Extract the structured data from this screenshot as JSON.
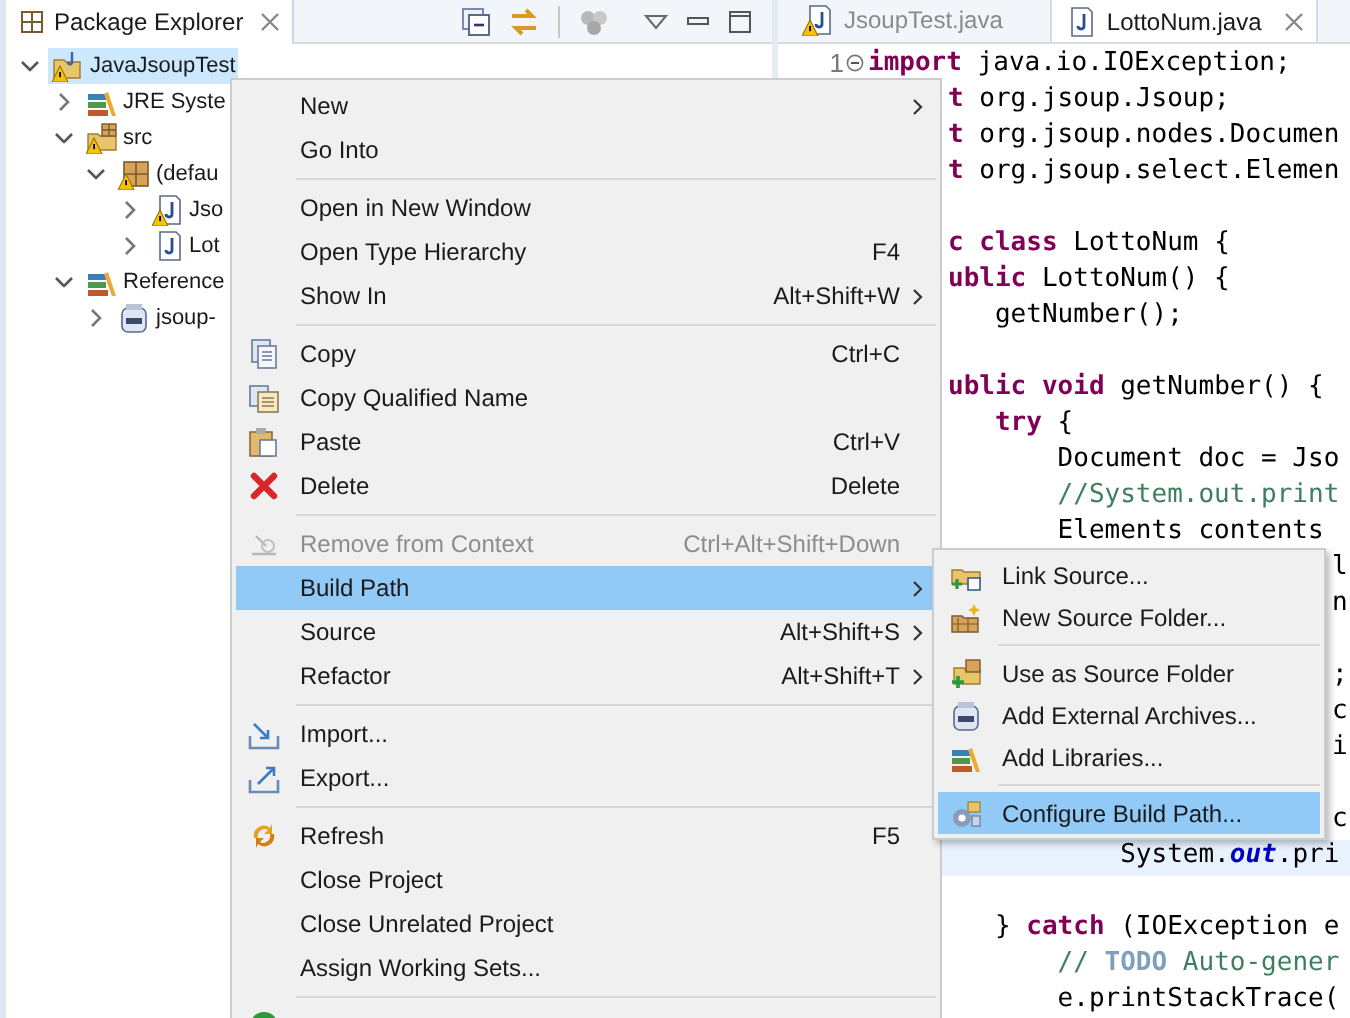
{
  "package_explorer": {
    "title": "Package Explorer",
    "selected": true,
    "tree": [
      {
        "label": "JavaJsoupTest",
        "kind": "project",
        "expanded": true,
        "selected": true,
        "warning": true,
        "children": [
          {
            "label": "JRE Syste",
            "kind": "library",
            "expanded": false,
            "selected": false
          },
          {
            "label": "src",
            "kind": "folder",
            "expanded": true,
            "selected": false,
            "warning": true,
            "children": [
              {
                "label": "(defau",
                "kind": "package",
                "expanded": true,
                "selected": false,
                "warning": true,
                "children": [
                  {
                    "label": "Jso",
                    "kind": "file",
                    "expanded": false,
                    "selected": false,
                    "warning": true
                  },
                  {
                    "label": "Lot",
                    "kind": "file",
                    "expanded": false,
                    "selected": false,
                    "warning": false
                  }
                ]
              }
            ]
          },
          {
            "label": "Reference",
            "kind": "library",
            "expanded": true,
            "selected": false,
            "children": [
              {
                "label": "jsoup-",
                "kind": "jar",
                "expanded": false,
                "selected": false
              }
            ]
          }
        ]
      }
    ]
  },
  "editor": {
    "tabs": [
      {
        "label": "JsoupTest.java",
        "selected": false,
        "warning": true
      },
      {
        "label": "LottoNum.java",
        "selected": true,
        "warning": false
      }
    ],
    "lines": [
      {
        "kind": "full",
        "number": "1",
        "text": "**import** java.io.IOException;",
        "comment": false,
        "current": false
      },
      {
        "kind": "cut",
        "text": "**t** org.jsoup.Jsoup;",
        "comment": false,
        "current": false
      },
      {
        "kind": "cut",
        "text": "**t** org.jsoup.nodes.Documen",
        "comment": false,
        "current": false
      },
      {
        "kind": "cut",
        "text": "**t** org.jsoup.select.Elemen",
        "comment": false,
        "current": false
      },
      {
        "kind": "blank"
      },
      {
        "kind": "cut",
        "text": "**c class** LottoNum {",
        "comment": false,
        "current": false
      },
      {
        "kind": "cut",
        "text": "**ublic** LottoNum() {",
        "comment": false,
        "current": false
      },
      {
        "kind": "cut",
        "text": "   getNumber();",
        "comment": false,
        "current": false
      },
      {
        "kind": "blank"
      },
      {
        "kind": "cut",
        "text": "**ublic void** getNumber() {",
        "comment": false,
        "current": false
      },
      {
        "kind": "cut",
        "text": "   **try** {",
        "comment": false,
        "current": false
      },
      {
        "kind": "cut",
        "text": "       Document doc = Jso",
        "comment": false,
        "current": false
      },
      {
        "kind": "cut",
        "text": "       //System.out.print",
        "comment": true,
        "current": false
      },
      {
        "kind": "cut",
        "text": "       Elements contents",
        "comment": false,
        "current": false
      },
      {
        "kind": "tail",
        "text": "l"
      },
      {
        "kind": "tail",
        "text": "n"
      },
      {
        "kind": "blank"
      },
      {
        "kind": "tail",
        "text": ";"
      },
      {
        "kind": "tail",
        "text": "c"
      },
      {
        "kind": "tail",
        "text": "i"
      },
      {
        "kind": "blank"
      },
      {
        "kind": "tail",
        "text": "c"
      },
      {
        "kind": "cut",
        "text": "           System.*out*.pri",
        "comment": false,
        "current": true
      },
      {
        "kind": "blank"
      },
      {
        "kind": "cut",
        "text": "   } **catch** (IOException e",
        "comment": false,
        "current": false
      },
      {
        "kind": "cut",
        "text": "       // **TODO** Auto-gener",
        "comment": true,
        "current": false
      },
      {
        "kind": "cut",
        "text": "       e.printStackTrace(",
        "comment": false,
        "current": false
      }
    ]
  },
  "context_menu": {
    "groups": [
      [
        {
          "label": "New",
          "kind": "plain",
          "submenu": true,
          "disabled": false,
          "selected": false
        },
        {
          "label": "Go Into",
          "kind": "plain",
          "submenu": false,
          "disabled": false,
          "selected": false
        }
      ],
      [
        {
          "label": "Open in New Window",
          "kind": "plain",
          "submenu": false,
          "disabled": false,
          "selected": false
        },
        {
          "label": "Open Type Hierarchy",
          "kind": "plain",
          "shortcut": "F4",
          "submenu": false,
          "disabled": false,
          "selected": false
        },
        {
          "label": "Show In",
          "kind": "plain",
          "shortcut": "Alt+Shift+W",
          "submenu": true,
          "disabled": false,
          "selected": false
        }
      ],
      [
        {
          "label": "Copy",
          "kind": "copy",
          "shortcut": "Ctrl+C",
          "submenu": false,
          "disabled": false,
          "selected": false
        },
        {
          "label": "Copy Qualified Name",
          "kind": "copyname",
          "submenu": false,
          "disabled": false,
          "selected": false
        },
        {
          "label": "Paste",
          "kind": "paste",
          "shortcut": "Ctrl+V",
          "submenu": false,
          "disabled": false,
          "selected": false
        },
        {
          "label": "Delete",
          "kind": "delete",
          "shortcut": "Delete",
          "submenu": false,
          "disabled": false,
          "selected": false
        }
      ],
      [
        {
          "label": "Remove from Context",
          "kind": "remove",
          "shortcut": "Ctrl+Alt+Shift+Down",
          "submenu": false,
          "disabled": true,
          "selected": false
        },
        {
          "label": "Build Path",
          "kind": "plain",
          "submenu": true,
          "disabled": false,
          "selected": true
        },
        {
          "label": "Source",
          "kind": "plain",
          "shortcut": "Alt+Shift+S",
          "submenu": true,
          "disabled": false,
          "selected": false
        },
        {
          "label": "Refactor",
          "kind": "plain",
          "shortcut": "Alt+Shift+T",
          "submenu": true,
          "disabled": false,
          "selected": false
        }
      ],
      [
        {
          "label": "Import...",
          "kind": "import",
          "submenu": false,
          "disabled": false,
          "selected": false
        },
        {
          "label": "Export...",
          "kind": "export",
          "submenu": false,
          "disabled": false,
          "selected": false
        }
      ],
      [
        {
          "label": "Refresh",
          "kind": "refresh",
          "shortcut": "F5",
          "submenu": false,
          "disabled": false,
          "selected": false
        },
        {
          "label": "Close Project",
          "kind": "plain",
          "submenu": false,
          "disabled": false,
          "selected": false
        },
        {
          "label": "Close Unrelated Project",
          "kind": "plain",
          "submenu": false,
          "disabled": false,
          "selected": false
        },
        {
          "label": "Assign Working Sets...",
          "kind": "plain",
          "submenu": false,
          "disabled": false,
          "selected": false
        }
      ],
      [
        {
          "kind": "coverage"
        }
      ]
    ]
  },
  "build_path_submenu": {
    "groups": [
      [
        {
          "label": "Link Source...",
          "kind": "linksource",
          "selected": false
        },
        {
          "label": "New Source Folder...",
          "kind": "newfolder",
          "selected": false
        }
      ],
      [
        {
          "label": "Use as Source Folder",
          "kind": "usefolder",
          "selected": false
        },
        {
          "label": "Add External Archives...",
          "kind": "archive",
          "selected": false
        },
        {
          "label": "Add Libraries...",
          "kind": "libraries",
          "selected": false
        }
      ],
      [
        {
          "label": "Configure Build Path...",
          "kind": "configure",
          "selected": true
        }
      ]
    ]
  }
}
